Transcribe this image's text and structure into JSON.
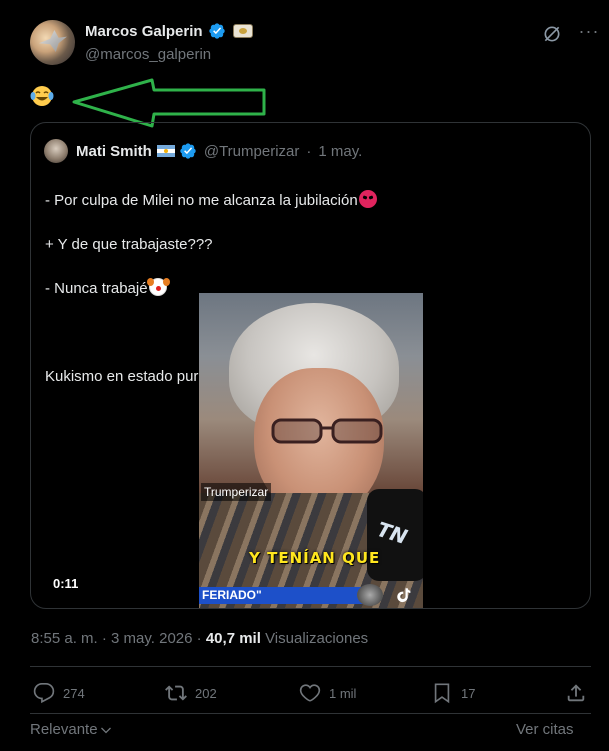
{
  "author": {
    "name": "Marcos Galperin",
    "handle": "@marcos_galperin",
    "icons": [
      "verified-badge-icon",
      "affiliate-badge-icon",
      "grok-icon",
      "more-icon"
    ]
  },
  "tweet": {
    "text_emoji": "face-with-tears-of-joy",
    "annotation": "green-arrow-pointing-left"
  },
  "quoted": {
    "name": "Mati Smith",
    "handle": "@Trumperizar",
    "separator": "·",
    "date": "1 may.",
    "lines": [
      "- Por culpa de Milei no me alcanza la jubilación",
      "+ Y de que trabajaste???",
      "- Nunca trabajé",
      "Kukismo en estado puro"
    ],
    "video": {
      "watermark": "Trumperizar",
      "caption": "Y TENÍAN QUE",
      "ticker": "FERIADO\"",
      "mic_logo": "TN",
      "duration": "0:11"
    }
  },
  "meta": {
    "time": "8:55 a. m.",
    "sep": "·",
    "date": "3 may. 2026",
    "views_count": "40,7 mil",
    "views_label": "Visualizaciones"
  },
  "actions": {
    "replies": "274",
    "reposts": "202",
    "likes": "1 mil",
    "bookmarks": "17"
  },
  "footer": {
    "sort_label": "Relevante",
    "quotes_link": "Ver citas"
  },
  "colors": {
    "background": "#000000",
    "text": "#e7e9ea",
    "muted": "#71767b",
    "border": "#2f3336",
    "verified": "#1d9bf0",
    "arrow": "#2fb24a"
  }
}
